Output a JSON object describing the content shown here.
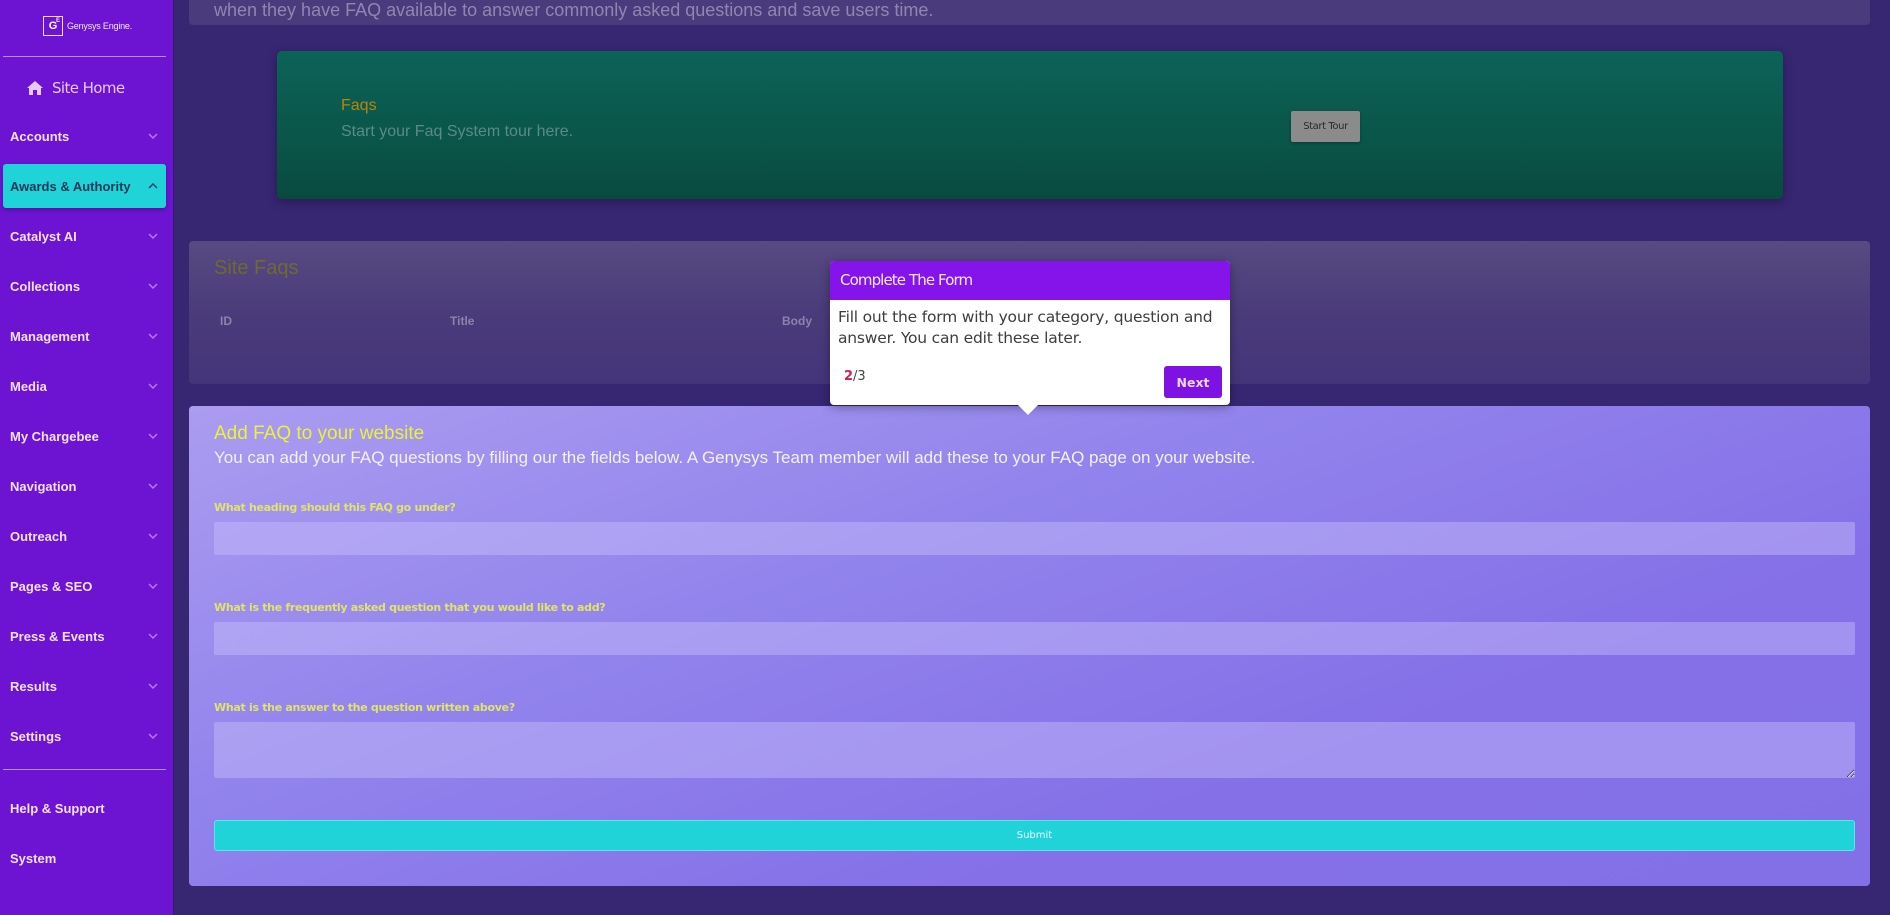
{
  "sidebar": {
    "logo": {
      "mark": "G",
      "mark_sup": "E",
      "text": "Genysys Engine."
    },
    "site_home": {
      "label": "Site Home",
      "icon": "home-icon"
    },
    "items": [
      {
        "label": "Accounts",
        "icon": "chevron-down-icon",
        "expanded": false
      },
      {
        "label": "Awards & Authority",
        "icon": "chevron-up-icon",
        "expanded": true
      },
      {
        "label": "Catalyst AI",
        "icon": "chevron-down-icon",
        "expanded": false
      },
      {
        "label": "Collections",
        "icon": "chevron-down-icon",
        "expanded": false
      },
      {
        "label": "Management",
        "icon": "chevron-down-icon",
        "expanded": false
      },
      {
        "label": "Media",
        "icon": "chevron-down-icon",
        "expanded": false
      },
      {
        "label": "My Chargebee",
        "icon": "chevron-down-icon",
        "expanded": false
      },
      {
        "label": "Navigation",
        "icon": "chevron-down-icon",
        "expanded": false
      },
      {
        "label": "Outreach",
        "icon": "chevron-down-icon",
        "expanded": false
      },
      {
        "label": "Pages & SEO",
        "icon": "chevron-down-icon",
        "expanded": false
      },
      {
        "label": "Press & Events",
        "icon": "chevron-down-icon",
        "expanded": false
      },
      {
        "label": "Results",
        "icon": "chevron-down-icon",
        "expanded": false
      },
      {
        "label": "Settings",
        "icon": "chevron-down-icon",
        "expanded": false
      }
    ],
    "footer_items": [
      {
        "label": "Help & Support"
      },
      {
        "label": "System"
      }
    ]
  },
  "intro": {
    "text": "when they have FAQ available to answer commonly asked questions and save users time."
  },
  "tour_banner": {
    "title": "Faqs",
    "subtitle": "Start your Faq System tour here.",
    "button_label": "Start Tour"
  },
  "site_faqs": {
    "title": "Site Faqs",
    "columns": [
      "ID",
      "Title",
      "Body"
    ],
    "rows": []
  },
  "add_faq": {
    "title": "Add FAQ to your website",
    "subtitle": "You can add your FAQ questions by filling our the fields below. A Genysys Team member will add these to your FAQ page on your website.",
    "fields": [
      {
        "label": "What heading should this FAQ go under?",
        "value": "",
        "placeholder": ""
      },
      {
        "label": "What is the frequently asked question that you would like to add?",
        "value": "",
        "placeholder": ""
      },
      {
        "label": "What is the answer to the question written above?",
        "value": "",
        "placeholder": ""
      }
    ],
    "submit_label": "Submit"
  },
  "tour_popover": {
    "title": "Complete The Form",
    "body": "Fill out the form with your category, question and answer. You can edit these later.",
    "step_current": "2",
    "step_total": "/3",
    "next_label": "Next"
  },
  "colors": {
    "sidebar_bg": "#6c14d2",
    "active_item": "#1fd3d9",
    "page_bg": "#372672",
    "popover_header": "#8414ea",
    "accent_yellow": "#eaf23a",
    "step_highlight": "#d81b4f"
  }
}
